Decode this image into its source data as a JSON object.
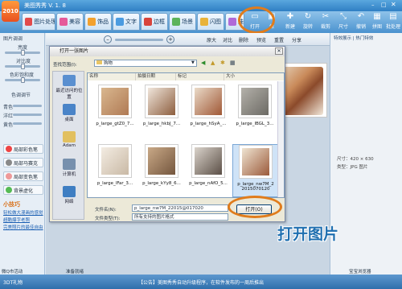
{
  "app": {
    "title": "美图秀秀 V. 1. 8",
    "logo_text": "2010"
  },
  "tabs": [
    {
      "label": "图片处理",
      "color": "#e34b4b"
    },
    {
      "label": "美容",
      "color": "#e55a9a"
    },
    {
      "label": "饰品",
      "color": "#f2a12e"
    },
    {
      "label": "文字",
      "color": "#4b9be0"
    },
    {
      "label": "边框",
      "color": "#d8443b"
    },
    {
      "label": "场景",
      "color": "#5cb35a"
    },
    {
      "label": "闪图",
      "color": "#e8b33a"
    },
    {
      "label": "娃",
      "color": "#b06ad8"
    }
  ],
  "toolbar": [
    {
      "label": "打开",
      "icon": "folder-icon"
    },
    {
      "label": "保",
      "icon": "save-icon"
    },
    {
      "label": "新建",
      "icon": "new-icon"
    },
    {
      "label": "旋转",
      "icon": "rotate-icon"
    },
    {
      "label": "裁剪",
      "icon": "crop-icon"
    },
    {
      "label": "尺寸",
      "icon": "resize-icon"
    },
    {
      "label": "撤销",
      "icon": "undo-icon"
    },
    {
      "label": "拼图",
      "icon": "collage-icon"
    },
    {
      "label": "批处理",
      "icon": "batch-icon"
    }
  ],
  "left_panel": {
    "header": "图片调调",
    "adjust_labels": [
      "亮度",
      "对比度",
      "色彩饱和度",
      "色调调节"
    ],
    "colors": [
      "青色",
      "洋红",
      "黄色"
    ],
    "effects": [
      {
        "label": "局部彩色笔",
        "color": "#e44"
      },
      {
        "label": "局部马赛克",
        "color": "#888"
      },
      {
        "label": "局部变色笔",
        "color": "#e99"
      },
      {
        "label": "背景虚化",
        "color": "#5b5"
      }
    ],
    "tips_title": "小技巧",
    "tips": [
      "轻松做大漫画的感觉",
      "超酷爆字老照",
      "完美照片的最佳自由"
    ]
  },
  "canvas_toolbar": {
    "zoom_value": "",
    "buttons": [
      "原大",
      "对比",
      "删除",
      "预览",
      "重置",
      "分享"
    ]
  },
  "right_panel": {
    "header": "特效展示  |  热门特效",
    "info_size": "尺寸：420 × 630",
    "info_type": "类型：JPG 图片"
  },
  "dialog": {
    "title": "打开一张图片",
    "lookin_label": "查找范围(I):",
    "lookin_value": "购物",
    "places": [
      "最近访问的位置",
      "桌面",
      "Adam",
      "计算机",
      "网络"
    ],
    "columns": [
      "名称",
      "拍摄日期",
      "标记",
      "大小"
    ],
    "files": [
      {
        "name": "p_large_gtZ0_7...",
        "tone": "#b07a54"
      },
      {
        "name": "p_large_hkbJ_7...",
        "tone": "#8d5e3e"
      },
      {
        "name": "p_large_hSyA_...",
        "tone": "#a05836"
      },
      {
        "name": "p_large_lBGL_3...",
        "tone": "#6c6a64"
      },
      {
        "name": "p_large_lFar_3...",
        "tone": "#c9b9a5"
      },
      {
        "name": "p_large_kYy8_6...",
        "tone": "#74563e"
      },
      {
        "name": "p_large_nAfO_5...",
        "tone": "#5b4f46"
      },
      {
        "name": "p_large_nw7M_2\n2015070120",
        "tone": "#9b5a3a"
      }
    ],
    "filename_label": "文件名(N):",
    "filename_value": "p_large_nw7M_22015@017020",
    "filetype_label": "文件类型(T):",
    "filetype_value": "所有支持的图片格式",
    "open_button": "打开(O)",
    "cancel_button": "取消"
  },
  "status": {
    "left1": "微Q市活动",
    "left2": "准备就绪",
    "notice": "【公告】美图秀秀自动升级程序，在软件发布的一周后推出",
    "right": "宝宝浏览器",
    "version": "3DT礼物"
  },
  "annotation": "打开图片",
  "accent": "#e07c1c"
}
